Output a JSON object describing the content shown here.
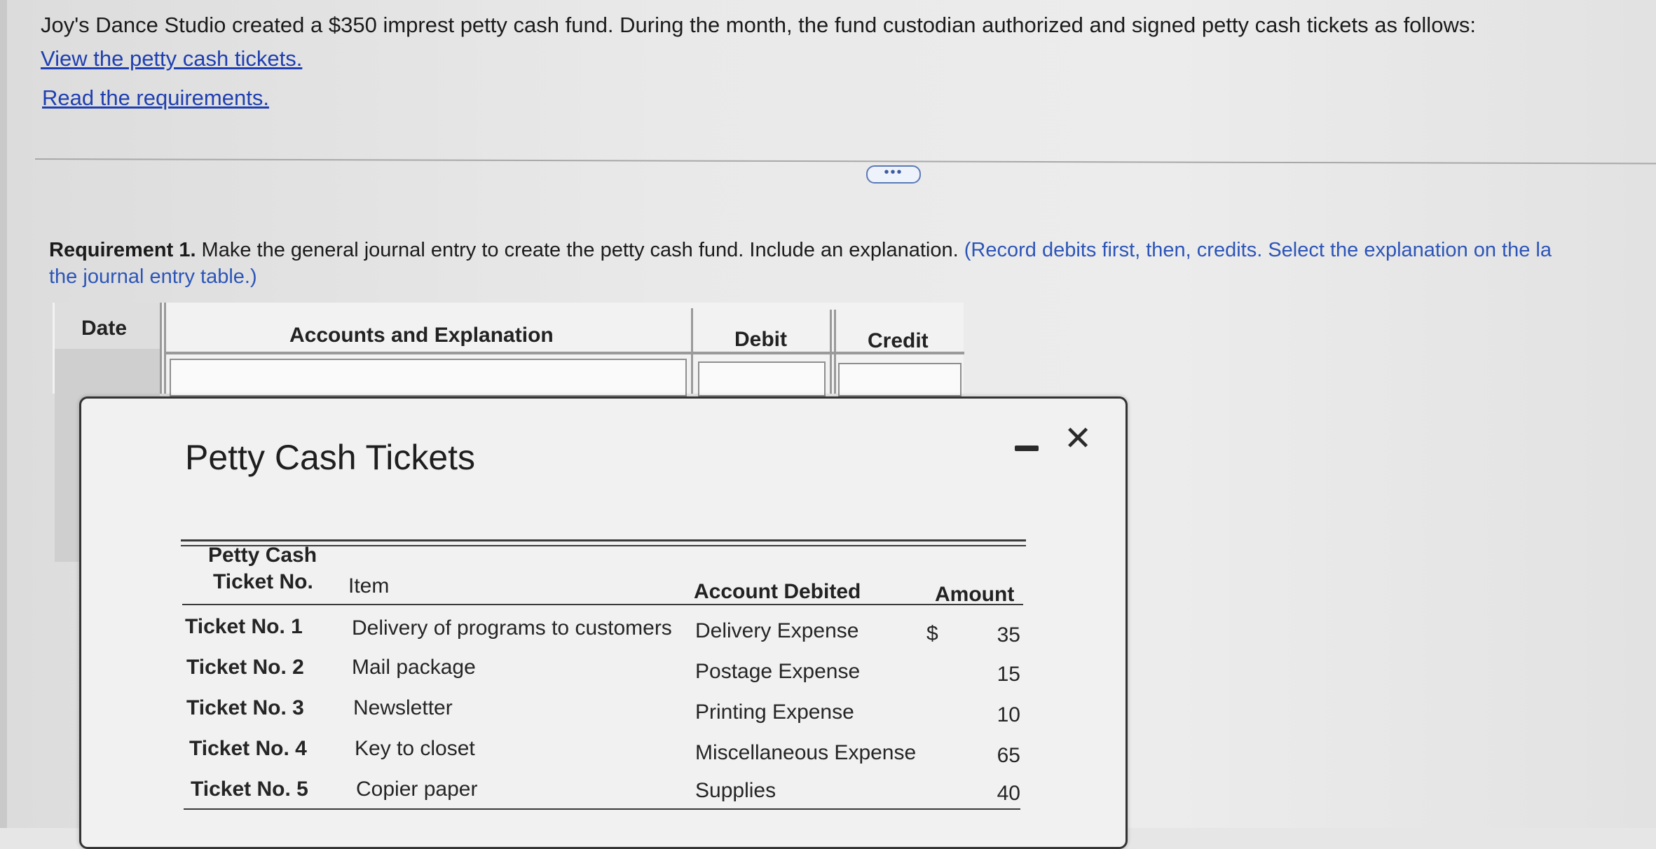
{
  "intro": {
    "text": "Joy's Dance Studio created a $350 imprest petty cash fund. During the month, the fund custodian authorized and signed petty cash tickets as follows:",
    "links": {
      "tickets": "View the petty cash tickets.",
      "requirements": "Read the requirements."
    }
  },
  "more_button": "•••",
  "requirement": {
    "label": "Requirement 1.",
    "text": " Make the general journal entry to create the petty cash fund. Include an explanation. ",
    "hint": "(Record debits first, then, credits. Select the explanation on the la",
    "hint_cont": "the journal entry table.)"
  },
  "journal_table": {
    "headers": [
      "Date",
      "Accounts and Explanation",
      "Debit",
      "Credit"
    ]
  },
  "modal": {
    "title": "Petty Cash Tickets",
    "minimize": "minimize",
    "close": "✕",
    "table": {
      "headers": {
        "ticket_no_line1": "Petty Cash",
        "ticket_no_line2": "Ticket No.",
        "item": "Item",
        "account": "Account Debited",
        "amount": "Amount"
      },
      "currency_symbol": "$",
      "rows": [
        {
          "ticket": "Ticket No. 1",
          "item": "Delivery of programs to customers",
          "account": "Delivery Expense",
          "amount": "35"
        },
        {
          "ticket": "Ticket No. 2",
          "item": "Mail package",
          "account": "Postage Expense",
          "amount": "15"
        },
        {
          "ticket": "Ticket No. 3",
          "item": "Newsletter",
          "account": "Printing Expense",
          "amount": "10"
        },
        {
          "ticket": "Ticket No. 4",
          "item": "Key to closet",
          "account": "Miscellaneous Expense",
          "amount": "65"
        },
        {
          "ticket": "Ticket No. 5",
          "item": "Copier paper",
          "account": "Supplies",
          "amount": "40"
        }
      ]
    }
  }
}
